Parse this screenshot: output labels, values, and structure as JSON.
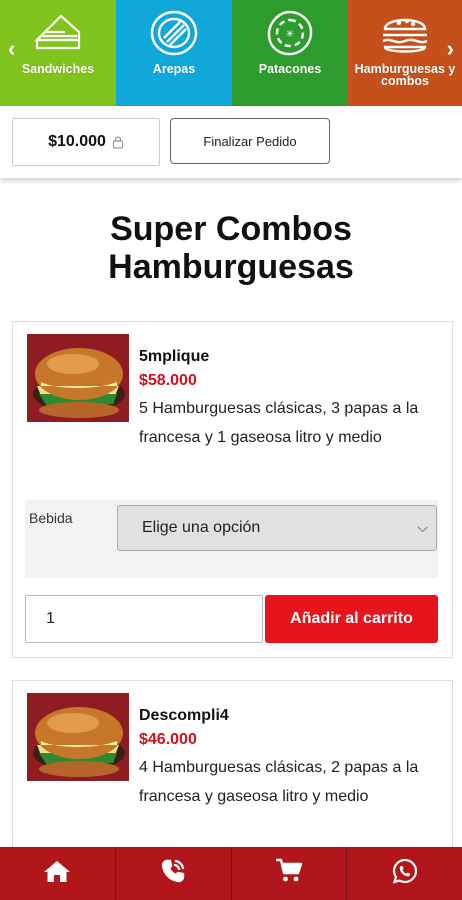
{
  "categories": [
    {
      "label": "Sandwiches",
      "color": "#7fc31c",
      "icon": "sandwich-icon"
    },
    {
      "label": "Arepas",
      "color": "#10a7db",
      "icon": "arepa-icon"
    },
    {
      "label": "Patacones",
      "color": "#2e9b2e",
      "icon": "patacon-icon"
    },
    {
      "label": "Hamburguesas y combos",
      "color": "#c5501b",
      "icon": "burger-icon"
    }
  ],
  "cart": {
    "total": "$10.000",
    "finalize_label": "Finalizar Pedido"
  },
  "page": {
    "title": "Super Combos Hamburguesas"
  },
  "products": [
    {
      "name": "5mplique",
      "price": "$58.000",
      "description": "5 Hamburguesas clásicas, 3 papas a la francesa y 1 gaseosa litro y medio",
      "option_label": "Bebida",
      "option_selected": "Elige una opción",
      "quantity": "1",
      "add_label": "Añadir al carrito"
    },
    {
      "name": "Descompli4",
      "price": "$46.000",
      "description": "4 Hamburguesas clásicas, 2 papas a la francesa y gaseosa litro y medio"
    }
  ],
  "bottom_nav": [
    {
      "icon": "home-icon"
    },
    {
      "icon": "phone-icon"
    },
    {
      "icon": "cart-icon"
    },
    {
      "icon": "whatsapp-icon"
    }
  ],
  "colors": {
    "accent_red": "#e8131b",
    "price_red": "#d0121b",
    "nav_red": "#b0161b"
  }
}
